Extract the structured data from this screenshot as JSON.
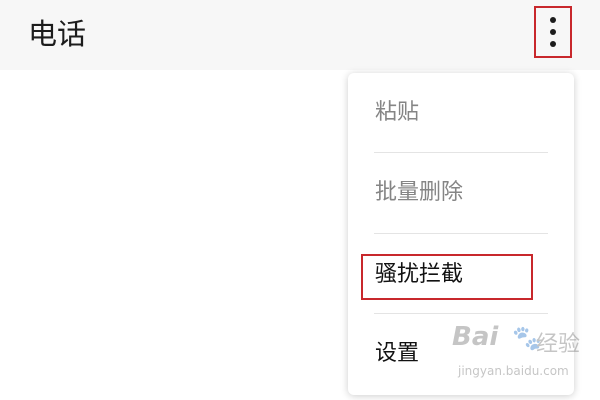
{
  "header": {
    "title": "电话",
    "more_icon": "more-vertical-icon"
  },
  "menu": {
    "items": [
      {
        "label": "粘贴",
        "enabled": false
      },
      {
        "label": "批量删除",
        "enabled": false
      },
      {
        "label": "骚扰拦截",
        "enabled": true,
        "highlighted": true
      },
      {
        "label": "设置",
        "enabled": true
      }
    ]
  },
  "annotation": {
    "highlight_color": "#c8282c"
  },
  "watermark": {
    "brand": "Bai",
    "brand_suffix": "经验",
    "url": "jingyan.baidu.com"
  }
}
